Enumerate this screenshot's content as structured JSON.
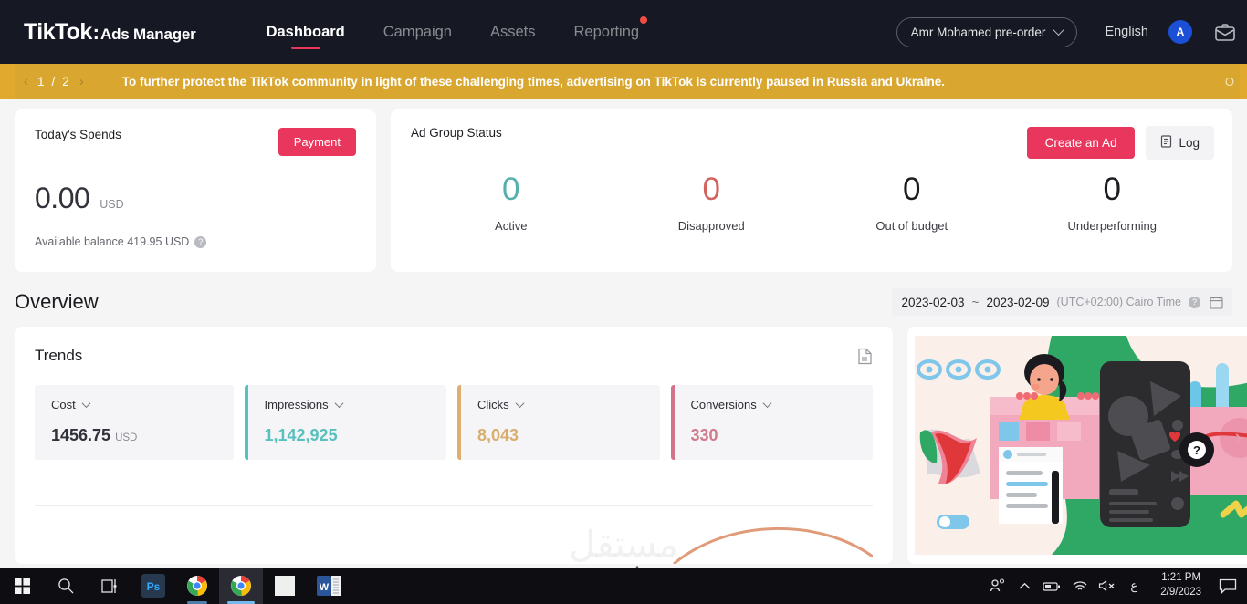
{
  "topnav": {
    "brand_main": "TikTok",
    "brand_colon": ":",
    "brand_sub": "Ads Manager",
    "items": [
      {
        "label": "Dashboard",
        "active": true,
        "dot": false
      },
      {
        "label": "Campaign",
        "active": false,
        "dot": false
      },
      {
        "label": "Assets",
        "active": false,
        "dot": false
      },
      {
        "label": "Reporting",
        "active": false,
        "dot": true
      }
    ],
    "account": "Amr Mohamed pre-order",
    "language": "English",
    "avatar_initial": "A",
    "accent_color": "#e8365d"
  },
  "banner": {
    "page_current": "1",
    "page_sep": "/",
    "page_total": "2",
    "prev_arrow": "‹",
    "next_arrow": "›",
    "message": "To further protect the TikTok community in light of these challenging times, advertising on TikTok is currently paused in Russia and Ukraine.",
    "right_text": "O",
    "background": "#d9a62f"
  },
  "spends": {
    "title": "Today's Spends",
    "payment_label": "Payment",
    "amount": "0.00",
    "currency": "USD",
    "balance_text": "Available balance 419.95 USD",
    "help_glyph": "?"
  },
  "ad_group_status": {
    "title": "Ad Group Status",
    "create_label": "Create an Ad",
    "log_label": "Log",
    "metrics": [
      {
        "label": "Active",
        "value": "0",
        "color": "#55b0ad"
      },
      {
        "label": "Disapproved",
        "value": "0",
        "color": "#d4625f"
      },
      {
        "label": "Out of budget",
        "value": "0",
        "color": "#1c1c20"
      },
      {
        "label": "Underperforming",
        "value": "0",
        "color": "#1c1c20"
      }
    ]
  },
  "overview": {
    "title": "Overview",
    "date_start": "2023-02-03",
    "date_sep": "~",
    "date_end": "2023-02-09",
    "timezone": "(UTC+02:00) Cairo Time",
    "help_glyph": "?"
  },
  "trends": {
    "title": "Trends",
    "metrics": [
      {
        "label": "Cost",
        "value": "1456.75",
        "currency": "USD",
        "color": "#31323a",
        "border": "transparent"
      },
      {
        "label": "Impressions",
        "value": "1,142,925",
        "currency": "",
        "color": "#58c0bd",
        "border": "#58c0bd"
      },
      {
        "label": "Clicks",
        "value": "8,043",
        "currency": "",
        "color": "#d9ae6d",
        "border": "#dcb071"
      },
      {
        "label": "Conversions",
        "value": "330",
        "currency": "",
        "color": "#d1798c",
        "border": "#d2738a"
      }
    ]
  },
  "promo": {
    "help_glyph": "?",
    "next_arrow": "›"
  },
  "watermark": {
    "arabic": "مستقل",
    "url": "mostaql.com"
  },
  "taskbar": {
    "apps": [
      {
        "name": "start"
      },
      {
        "name": "search"
      },
      {
        "name": "task-view"
      },
      {
        "name": "photoshop",
        "label": "Ps"
      },
      {
        "name": "chrome-1"
      },
      {
        "name": "chrome-2"
      },
      {
        "name": "window"
      },
      {
        "name": "word",
        "label": "W"
      }
    ],
    "tray": {
      "people": "⛹",
      "chevron": "∧",
      "battery": "▭",
      "wifi": "◠",
      "volume": "◁",
      "ime": "ع",
      "time": "1:21 PM",
      "date": "2/9/2023"
    }
  }
}
